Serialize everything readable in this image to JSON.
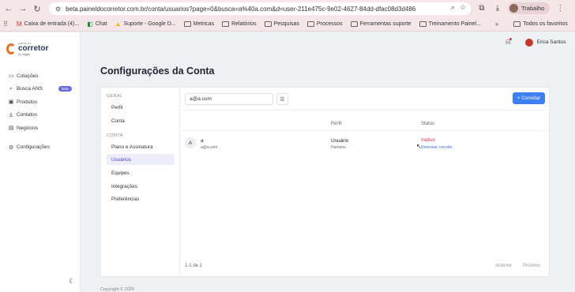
{
  "browser": {
    "url": "beta.paineldocorretor.com.br/conta/usuarios?page=0&busca=a%40a.com&d=user-211e475c-9e02-4627-84dd-dfac08d3d486",
    "profile_label": "Trabalho",
    "bookmarks": [
      {
        "label": "Caixa de entrada (4)..."
      },
      {
        "label": "Chat"
      },
      {
        "label": "Suporte - Google D..."
      },
      {
        "label": "Metricas"
      },
      {
        "label": "Relatórios"
      },
      {
        "label": "Pesquisas"
      },
      {
        "label": "Processos"
      },
      {
        "label": "Ferramentas suporte"
      },
      {
        "label": "Treinamento Painel..."
      }
    ],
    "all_favorites": "Todos os favoritos"
  },
  "logo": {
    "small": "painel do",
    "name": "corretor",
    "by": "by agger"
  },
  "sidebar": {
    "items": [
      {
        "label": "Cotações",
        "icon": "document-icon"
      },
      {
        "label": "Busca ANS",
        "icon": "search-icon",
        "badge": "beta"
      },
      {
        "label": "Produtos",
        "icon": "box-icon"
      },
      {
        "label": "Contatos",
        "icon": "person-icon"
      },
      {
        "label": "Negócios",
        "icon": "briefcase-icon"
      },
      {
        "label": "Configurações",
        "icon": "gear-icon"
      }
    ]
  },
  "header": {
    "title": "Configurações da Conta",
    "user_name": "Erica Santos"
  },
  "settings_nav": {
    "section_general": "GERAL",
    "general": [
      "Perfil",
      "Conta"
    ],
    "section_account": "CONTA",
    "account": [
      "Plano e Assinatura",
      "Usuários",
      "Equipes",
      "Integrações",
      "Preferências"
    ]
  },
  "users": {
    "search_value": "a@a.com",
    "invite_label": "+ Convidar",
    "columns": {
      "profile": "Perfil",
      "status": "Status"
    },
    "rows": [
      {
        "initial": "A",
        "name": "a",
        "email": "a@a.com",
        "role": "Usuário",
        "team": "Humans",
        "status": "Inativo",
        "action": "Reenviar convite"
      }
    ],
    "count": "1-1 de 1",
    "prev": "Anterior",
    "next": "Próximo"
  },
  "footer": {
    "copyright": "Copyright © 2025"
  },
  "colors": {
    "accent": "#3d7ef0",
    "active_nav": "#4a48c7",
    "inactive_status": "#e0344b"
  }
}
